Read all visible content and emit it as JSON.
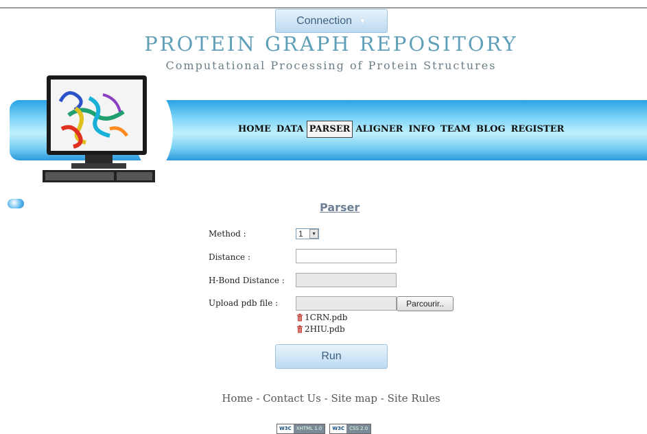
{
  "header": {
    "connection_label": "Connection",
    "title": "PROTEIN GRAPH REPOSITORY",
    "subtitle": "Computational Processing of Protein Structures"
  },
  "nav": {
    "items": [
      "HOME",
      "DATA",
      "PARSER",
      "ALIGNER",
      "INFO",
      "TEAM",
      "BLOG",
      "REGISTER"
    ],
    "active": "PARSER"
  },
  "form": {
    "heading": "Parser",
    "method_label": "Method :",
    "method_value": "1",
    "distance_label": "Distance :",
    "distance_value": "",
    "hbond_label": "H-Bond Distance :",
    "hbond_value": "",
    "upload_label": "Upload pdb file :",
    "upload_value": "",
    "browse_label": "Parcourir..",
    "files": [
      "1CRN.pdb",
      "2HIU.pdb"
    ],
    "run_label": "Run"
  },
  "footer": {
    "links": [
      "Home",
      "Contact Us",
      "Site map",
      "Site Rules"
    ],
    "separator": " - ",
    "badges": [
      {
        "w3c": "W3C",
        "std": "XHTML 1.0"
      },
      {
        "w3c": "W3C",
        "std": "CSS 2.0"
      }
    ]
  },
  "colors": {
    "title": "#5f9fb8",
    "banner": "#2aa3e6",
    "button_bg": "#bcdaf1",
    "trash_icon": "#c0392b"
  }
}
